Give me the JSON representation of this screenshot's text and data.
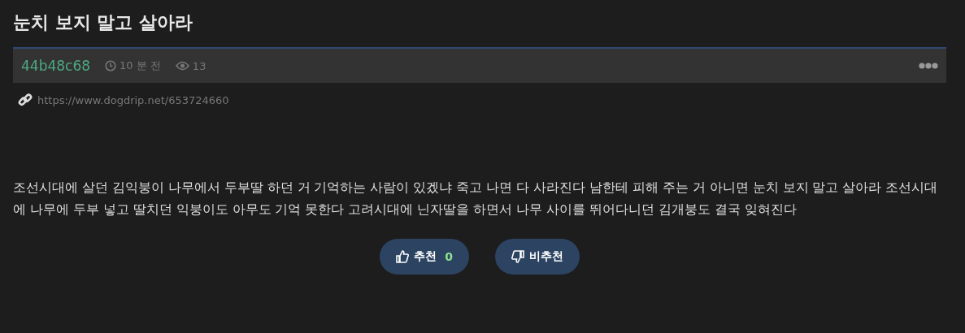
{
  "title": "눈치 보지 말고 살아라",
  "meta": {
    "author": "44b48c68",
    "time": "10 분 전",
    "views": "13"
  },
  "link": "https://www.dogdrip.net/653724660",
  "body": "조선시대에 살던 김익붕이 나무에서 두부딸 하던 거 기억하는 사람이 있겠냐 죽고 나면 다 사라진다 남한테 피해 주는 거 아니면 눈치 보지 말고 살아라 조선시대에 나무에 두부 넣고 딸치던 익붕이도 아무도 기억 못한다 고려시대에 닌자딸을 하면서 나무 사이를 뛰어다니던 김개붕도 결국 잊혀진다",
  "vote": {
    "up_label": "추천",
    "up_count": "0",
    "down_label": "비추천"
  }
}
